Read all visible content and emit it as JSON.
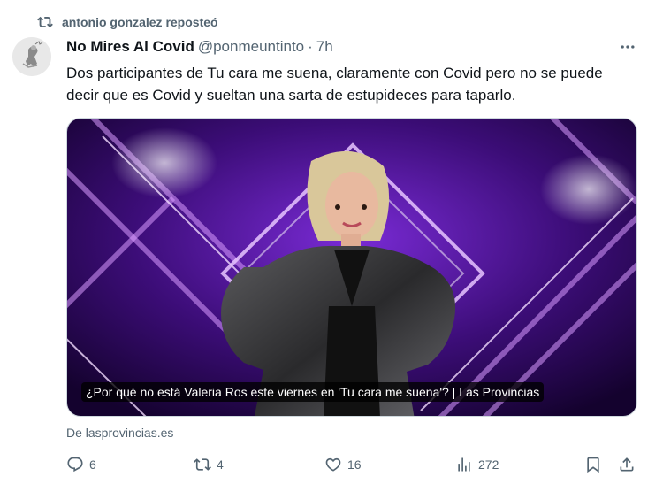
{
  "repost": {
    "label": "antonio gonzalez reposteó",
    "icon": "repost-icon"
  },
  "tweet": {
    "author_name": "No Mires Al Covid",
    "handle": "@ponmeuntinto",
    "separator": "·",
    "time": "7h",
    "more_icon": "more-icon",
    "text": "Dos participantes de Tu cara me suena, claramente con Covid pero no se puede decir que es Covid y sueltan una sarta de estupideces para taparlo."
  },
  "card": {
    "caption": "¿Por qué no está Valeria Ros este viernes en 'Tu cara me suena'? | Las Provincias",
    "source": "De lasprovincias.es"
  },
  "actions": {
    "replies": "6",
    "reposts": "4",
    "likes": "16",
    "views": "272"
  },
  "colors": {
    "muted": "#536471",
    "text": "#0f1419",
    "card_bg": "#3a0a6a"
  }
}
